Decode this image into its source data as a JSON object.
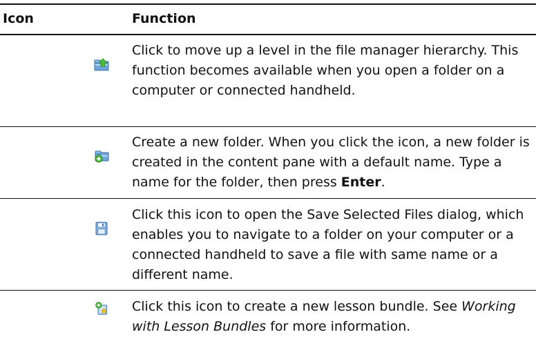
{
  "table": {
    "headers": {
      "icon": "Icon",
      "function": "Function"
    },
    "rows": [
      {
        "icon": "up-level-folder-icon",
        "text": "Click to move up a level in the file manager hierarchy. This function becomes available when you open a folder on a computer or connected handheld."
      },
      {
        "icon": "new-folder-icon",
        "text_before": "Create a new folder. When you click the icon, a new folder is created in the content pane with a default name. Type a name for the folder, then press ",
        "text_bold": "Enter",
        "text_after": "."
      },
      {
        "icon": "save-icon",
        "text": "Click this icon to open the Save Selected Files dialog, which enables you to navigate to a folder on your computer or a connected handheld to save a file with same name or a different name."
      },
      {
        "icon": "new-lesson-bundle-icon",
        "text_before": "Click this icon to create a new lesson bundle. See ",
        "text_italic": "Working with Lesson Bundles",
        "text_after": " for more information."
      }
    ]
  }
}
